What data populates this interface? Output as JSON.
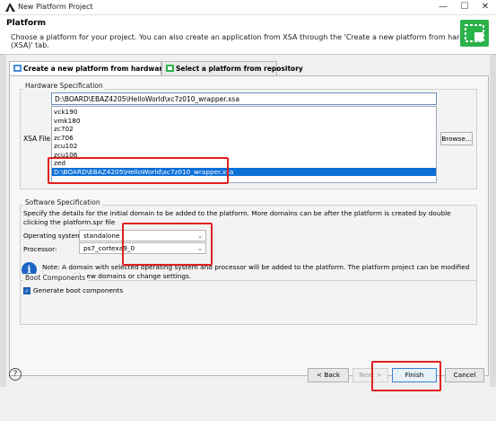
{
  "window": {
    "title": "New Platform Project"
  },
  "header": {
    "title": "Platform",
    "description": "Choose a platform for your project. You can also create an application from XSA through the 'Create a new platform from hardware (XSA)' tab."
  },
  "tabs": [
    {
      "label": "Create a new platform from hardware (XSA)",
      "active": true
    },
    {
      "label": "Select a platform from repository",
      "active": false
    }
  ],
  "hardware": {
    "group_label": "Hardware Specification",
    "xsa_label": "XSA File:",
    "xsa_value": "D:\\BOARD\\EBAZ4205\\HelloWorld\\xc7z010_wrapper.xsa",
    "options": [
      "vck190",
      "vmk180",
      "zc702",
      "zc706",
      "zcu102",
      "zcu106",
      "zed",
      "D:\\BOARD\\EBAZ4205\\HelloWorld\\xc7z010_wrapper.xsa"
    ],
    "selected_index": 7,
    "browse_label": "Browse..."
  },
  "software": {
    "group_label": "Software Specification",
    "description": "Specify the details for the initial domain to be added to the platform. More domains can be after the platform is created by double clicking the platform.spr file",
    "os_label": "Operating system:",
    "os_value": "standalone",
    "proc_label": "Processor:",
    "proc_value": "ps7_cortexa9_0",
    "note": "Note: A domain with selected operating system and processor will be added to the platform. The platform project can be modified later to add new domains or change settings."
  },
  "boot": {
    "group_label": "Boot Components",
    "checkbox_label": "Generate boot components",
    "checked": true
  },
  "buttons": {
    "help": "?",
    "back": "< Back",
    "next": "Next >",
    "finish": "Finish",
    "cancel": "Cancel"
  },
  "window_controls": {
    "minimize": "—",
    "maximize": "☐",
    "close": "✕"
  },
  "colors": {
    "accent": "#0b70d8",
    "highlight": "#e02020",
    "header_icon": "#2bb34b"
  }
}
